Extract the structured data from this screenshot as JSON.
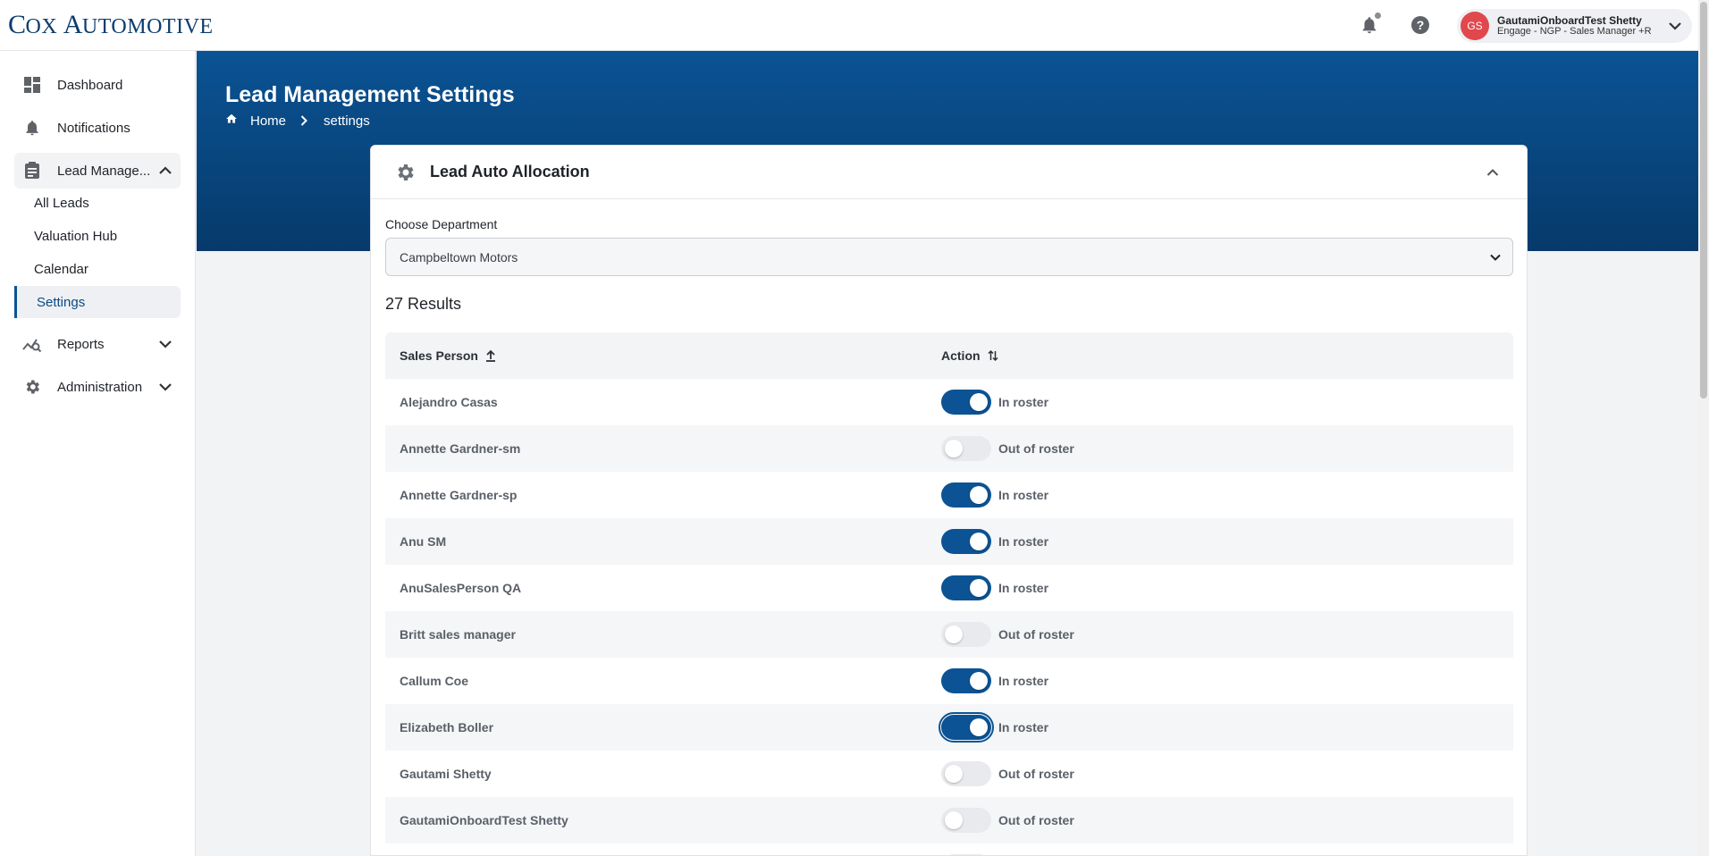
{
  "brand": {
    "logo_text_big1": "C",
    "logo_text_small1": "OX ",
    "logo_text_big2": "A",
    "logo_text_small2": "UTOMOTIVE"
  },
  "header": {
    "user": {
      "initials": "GS",
      "name": "GautamiOnboardTest Shetty",
      "role": "Engage - NGP - Sales Manager +R"
    },
    "icons": [
      "bell-icon",
      "help-icon",
      "chevron-down-icon"
    ]
  },
  "sidebar": {
    "items": [
      {
        "label": "Dashboard",
        "icon": "dashboard-icon"
      },
      {
        "label": "Notifications",
        "icon": "bell-icon"
      },
      {
        "label": "Lead Manage...",
        "icon": "clipboard-icon",
        "expanded": true
      },
      {
        "label": "Reports",
        "icon": "reports-icon"
      },
      {
        "label": "Administration",
        "icon": "gear-icon"
      }
    ],
    "sub_items": [
      {
        "label": "All Leads"
      },
      {
        "label": "Valuation Hub"
      },
      {
        "label": "Calendar"
      },
      {
        "label": "Settings",
        "active": true
      }
    ]
  },
  "page": {
    "title": "Lead Management Settings",
    "breadcrumb": {
      "home": "Home",
      "current": "settings"
    }
  },
  "card": {
    "title": "Lead Auto Allocation",
    "department_label": "Choose Department",
    "department_value": "Campbeltown Motors",
    "results": "27 Results",
    "columns": {
      "person": "Sales Person",
      "action": "Action"
    },
    "rows": [
      {
        "name": "Alejandro Casas",
        "status": "In roster",
        "on": true
      },
      {
        "name": "Annette Gardner-sm",
        "status": "Out of roster",
        "on": false
      },
      {
        "name": "Annette Gardner-sp",
        "status": "In roster",
        "on": true
      },
      {
        "name": "Anu SM",
        "status": "In roster",
        "on": true
      },
      {
        "name": "AnuSalesPerson QA",
        "status": "In roster",
        "on": true
      },
      {
        "name": "Britt sales manager",
        "status": "Out of roster",
        "on": false
      },
      {
        "name": "Callum Coe",
        "status": "In roster",
        "on": true
      },
      {
        "name": "Elizabeth Boller",
        "status": "In roster",
        "on": true,
        "focused": true
      },
      {
        "name": "Gautami Shetty",
        "status": "Out of roster",
        "on": false
      },
      {
        "name": "GautamiOnboardTest Shetty",
        "status": "Out of roster",
        "on": false
      },
      {
        "name": "",
        "status": "",
        "on": false
      }
    ]
  },
  "colors": {
    "primary": "#0b5394",
    "band_dark": "#063a6b",
    "avatar": "#e0484d"
  }
}
